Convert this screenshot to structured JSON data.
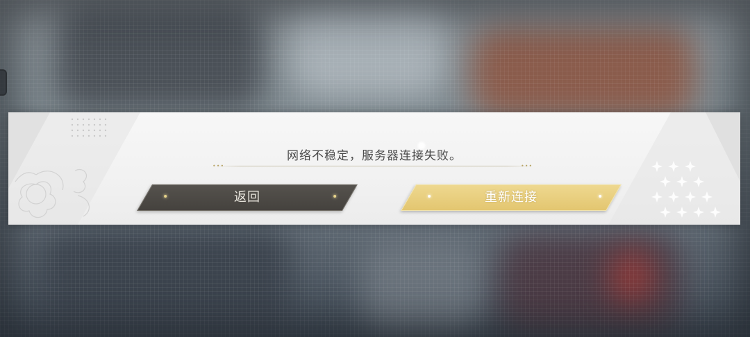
{
  "dialog": {
    "message": "网络不稳定，服务器连接失败。",
    "back_label": "返回",
    "reconnect_label": "重新连接"
  },
  "colors": {
    "back_button": "#4a4743",
    "reconnect_button": "#e8cf7e",
    "dialog_band": "#f2f2f2",
    "message_text": "#4a4a4a"
  },
  "icons": {
    "left_decoration": "flower-outline-icon",
    "right_decoration": "star-pattern-icon",
    "sparkle": "sparkle-icon"
  }
}
